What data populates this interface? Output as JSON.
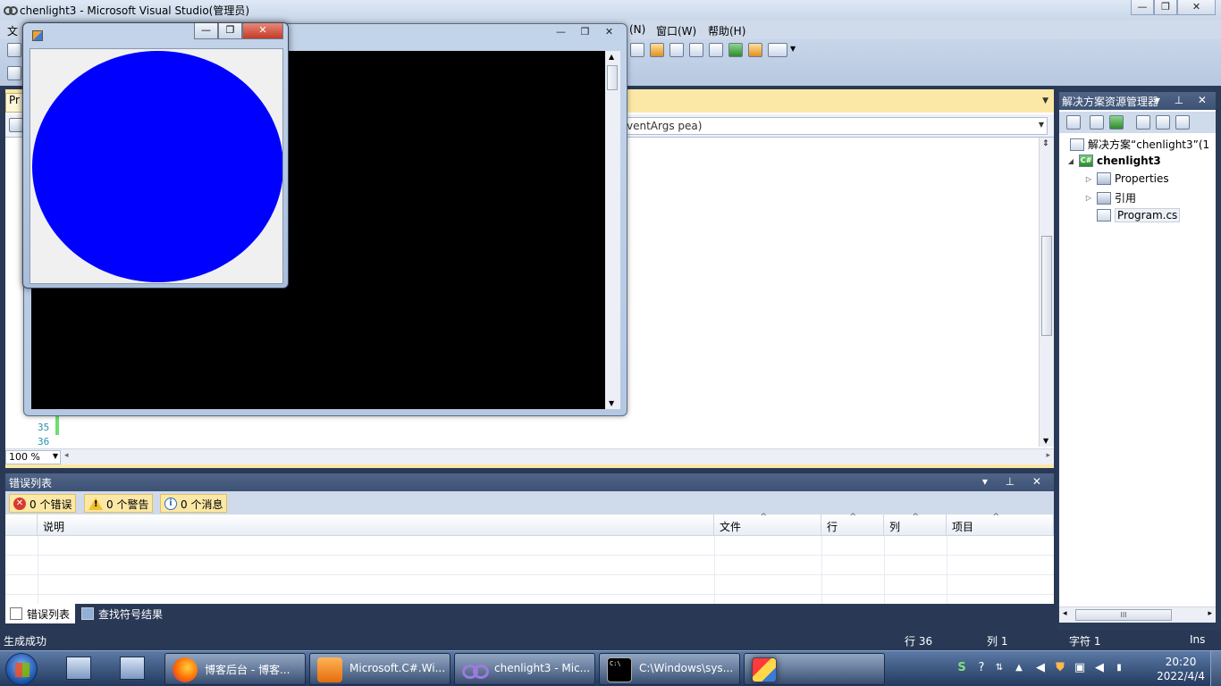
{
  "vs": {
    "title": "chenlight3 - Microsoft Visual Studio(管理员)",
    "menu": {
      "file_partial": "文",
      "n_partial": "(N)",
      "window": "窗口(W)",
      "help": "帮助(H)"
    },
    "editor": {
      "doc_tab_partial": "Pr",
      "member_combo": "ventArgs pea)",
      "line_35": "35",
      "line_36": "36",
      "zoom": "100 %"
    },
    "error_list": {
      "title": "错误列表",
      "errors_filter": "0 个错误",
      "warnings_filter": "0 个警告",
      "messages_filter": "0 个消息",
      "columns": [
        "说明",
        "文件",
        "行",
        "列",
        "项目"
      ],
      "bottom_tabs": [
        "错误列表",
        "查找符号结果"
      ]
    },
    "solution_explorer": {
      "title": "解决方案资源管理器",
      "solution": "解决方案“chenlight3”(1",
      "project": "chenlight3",
      "properties": "Properties",
      "references": "引用",
      "program": "Program.cs"
    },
    "status": {
      "message": "生成成功",
      "line": "行 36",
      "col": "列 1",
      "char": "字符 1",
      "mode": "Ins"
    }
  },
  "form": {
    "circle_color": "#0000ff"
  },
  "taskbar": {
    "tasks": [
      "博客后台 - 博客...",
      "Microsoft.C#.Wi...",
      "chenlight3 - Mic...",
      "C:\\Windows\\sys..."
    ],
    "clock_time": "20:20",
    "clock_date": "2022/4/4"
  }
}
